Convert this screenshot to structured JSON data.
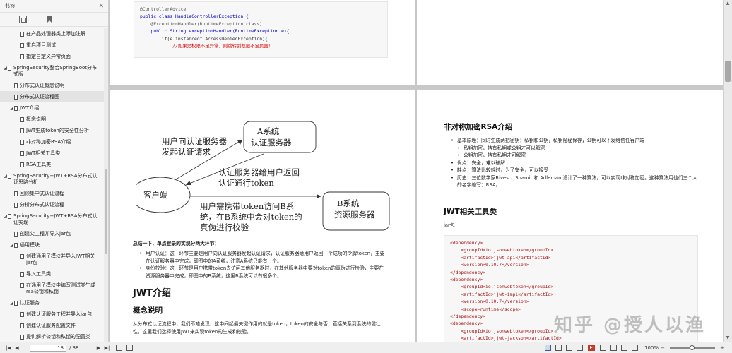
{
  "sidebar": {
    "title": "书签",
    "items": [
      {
        "label": "在产品处理器类上添加注解",
        "level": 2,
        "arrow": ""
      },
      {
        "label": "重启项目测试",
        "level": 2,
        "arrow": ""
      },
      {
        "label": "指定自定义异常页面",
        "level": 2,
        "arrow": ""
      },
      {
        "label": "SpringSecurity整合SpringBoot分布式版",
        "level": 0,
        "arrow": "◢"
      },
      {
        "label": "分布式认证概念说明",
        "level": 1,
        "arrow": ""
      },
      {
        "label": "分布式认证流程图",
        "level": 1,
        "arrow": "",
        "selected": true
      },
      {
        "label": "JWT介绍",
        "level": 1,
        "arrow": "◢"
      },
      {
        "label": "概念说明",
        "level": 2,
        "arrow": ""
      },
      {
        "label": "JWT生成token的安全性分析",
        "level": 2,
        "arrow": ""
      },
      {
        "label": "非对称加密RSA介绍",
        "level": 2,
        "arrow": ""
      },
      {
        "label": "JWT相关工具类",
        "level": 2,
        "arrow": ""
      },
      {
        "label": "RSA工具类",
        "level": 2,
        "arrow": ""
      },
      {
        "label": "SpringSecurity+JWT+RSA分布式认证思路分析",
        "level": 0,
        "arrow": "◢"
      },
      {
        "label": "回顾集中式认证流程",
        "level": 1,
        "arrow": ""
      },
      {
        "label": "分析分布式认证流程",
        "level": 1,
        "arrow": ""
      },
      {
        "label": "SpringSecurity+JWT+RSA分布式认证实现",
        "level": 0,
        "arrow": "◢"
      },
      {
        "label": "创建父工程并导入jar包",
        "level": 1,
        "arrow": ""
      },
      {
        "label": "通用模块",
        "level": 1,
        "arrow": "◢"
      },
      {
        "label": "创建通用子模块并导入JWT相关jar包",
        "level": 2,
        "arrow": ""
      },
      {
        "label": "导入工具类",
        "level": 2,
        "arrow": ""
      },
      {
        "label": "在通用子模块中编写测试类生成rsa公钥和私钥",
        "level": 2,
        "arrow": ""
      },
      {
        "label": "认证服务",
        "level": 1,
        "arrow": "◢"
      },
      {
        "label": "创建认证服务工程并导入jar包",
        "level": 2,
        "arrow": ""
      },
      {
        "label": "创建认证服务配置文件",
        "level": 2,
        "arrow": ""
      },
      {
        "label": "提供解析公钥和私钥的配置类",
        "level": 2,
        "arrow": ""
      }
    ]
  },
  "page1": {
    "code": [
      {
        "t": "@ControllerAdvice",
        "c": "ann"
      },
      {
        "t": "public class HandleControllerException {",
        "c": "kw"
      },
      {
        "t": "",
        "c": ""
      },
      {
        "t": "    @ExceptionHandler(RuntimeException.class)",
        "c": "ann"
      },
      {
        "t": "    public String exceptionHandler(RuntimeException e){",
        "c": "kw"
      },
      {
        "t": "        if(e instanceof AccessDeniedException){",
        "c": ""
      },
      {
        "t": "            //如果是权限不足异常，则跳转到权限不足页面！",
        "c": "cm"
      }
    ]
  },
  "diagram": {
    "label_user_auth": [
      "用户向认证服务器",
      "发起认证请求"
    ],
    "box_a": [
      "A系统",
      "认证服务器"
    ],
    "label_return": [
      "认证服务器给用户返回",
      "认证通行token"
    ],
    "client": "客户端",
    "box_b": [
      "B系统",
      "资源服务器"
    ],
    "label_carry": [
      "用户需携带token访问B系",
      "统，在B系统中会对token的",
      "真伪进行校验"
    ]
  },
  "page3": {
    "summary_title": "总结一下，单点登录的实现分两大环节：",
    "bullets": [
      "用户认证：这一环节主要是用户向认证服务器发起认证请求，认证服务器给用户返回一个成功的令牌token，主要在认证服务器中完成，即图中的A系统，注意A系统只能有一个。",
      "身份校验：这一环节是用户携带token去访问其他服务器时，在其他服务器中要对token的真伪进行检验，主要在资源服务器中完成，即图中的B系统，这里B系统可以有很多个。"
    ],
    "h1": "JWT介绍",
    "h2": "概念说明",
    "para": "从分布式认证流程中，我们不难发现，这中间起最关键作用的就是token，token的安全与否，直接关系到系统的健壮性，这里我们选择使用JWT来实现token的生成和校验。"
  },
  "page4": {
    "h_rsa": "非对称加密RSA介绍",
    "bullets": [
      {
        "t": "基本原理：同时生成两把密钥：私钥和公钥，私钥隐秘保存，公钥可以下发给信任客户端",
        "sub": false
      },
      {
        "t": "私钥加密，持有私钥或公钥才可以解密",
        "sub": true
      },
      {
        "t": "公钥加密，持有私钥才可解密",
        "sub": true
      },
      {
        "t": "优点：安全，难以破解",
        "sub": false
      },
      {
        "t": "缺点：算法比较耗时，为了安全，可以接受",
        "sub": false
      },
      {
        "t": "历史：三位数学家Rivest、Shamir 和 Adleman 设计了一种算法，可以实现非对称加密。这种算法用他们三个人的名字缩写：RSA。",
        "sub": false
      }
    ],
    "h_jwt": "JWT相关工具类",
    "jar_label": "jar包",
    "code": [
      "<dependency>",
      "    <groupId>io.jsonwebtoken</groupId>",
      "    <artifactId>jjwt-api</artifactId>",
      "    <version>0.10.7</version>",
      "</dependency>",
      "<dependency>",
      "    <groupId>io.jsonwebtoken</groupId>",
      "    <artifactId>jjwt-impl</artifactId>",
      "    <version>0.10.7</version>",
      "    <scope>runtime</scope>",
      "</dependency>",
      "<dependency>",
      "    <groupId>io.jsonwebtoken</groupId>",
      "    <artifactId>jjwt-jackson</artifactId>"
    ]
  },
  "watermark": "知乎 @授人以渔",
  "status": {
    "page_current": "18",
    "page_total": "/ 38",
    "zoom": "100%"
  }
}
